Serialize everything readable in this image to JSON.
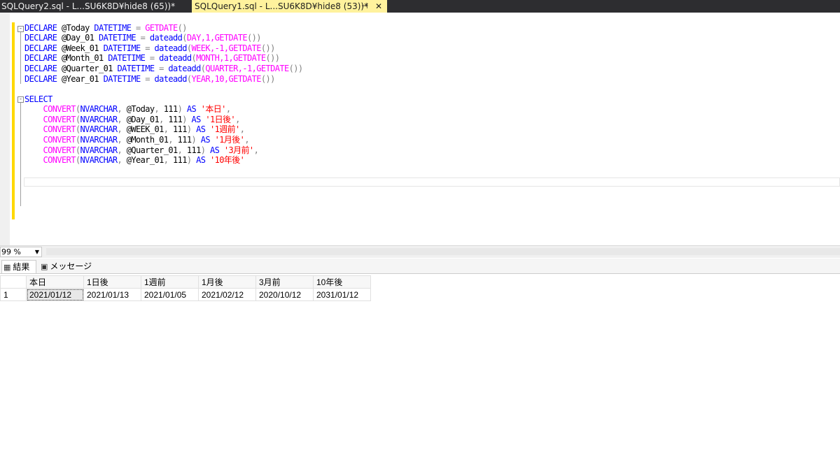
{
  "tabs": [
    {
      "label": "SQLQuery2.sql - L...SU6K8D¥hide8 (65))*",
      "active": false
    },
    {
      "label": "SQLQuery1.sql - L...SU6K8D¥hide8 (53))*",
      "active": true,
      "pin_icon": "pin-icon",
      "close_icon": "close-icon"
    }
  ],
  "editor": {
    "declares": [
      {
        "var": "@Today",
        "type": "DATETIME",
        "fn": "GETDATE",
        "args": ""
      },
      {
        "var": "@Day_01",
        "type": "DATETIME",
        "fn": "dateadd",
        "args": "DAY,1,"
      },
      {
        "var": "@Week_01",
        "type": "DATETIME",
        "fn": "dateadd",
        "args": "WEEK,-1,"
      },
      {
        "var": "@Month_01",
        "type": "DATETIME",
        "fn": "dateadd",
        "args": "MONTH,1,"
      },
      {
        "var": "@Quarter_01",
        "type": "DATETIME",
        "fn": "dateadd",
        "args": "QUARTER,-1,"
      },
      {
        "var": "@Year_01",
        "type": "DATETIME",
        "fn": "dateadd",
        "args": "YEAR,10,"
      }
    ],
    "select_keyword": "SELECT",
    "declare_keyword": "DECLARE",
    "converts": [
      {
        "var": "@Today",
        "alias": "'本日'",
        "sep": ","
      },
      {
        "var": "@Day_01",
        "alias": "'1日後'",
        "sep": ","
      },
      {
        "var": "@WEEK_01",
        "alias": "'1週前'",
        "sep": ","
      },
      {
        "var": "@Month_01",
        "alias": "'1月後'",
        "sep": ","
      },
      {
        "var": "@Quarter_01",
        "alias": "'3月前'",
        "sep": ","
      },
      {
        "var": "@Year_01",
        "alias": "'10年後'",
        "sep": ""
      }
    ]
  },
  "zoom": {
    "value": "99 %"
  },
  "result_tabs": [
    {
      "label": "結果",
      "icon": "grid-icon",
      "active": true
    },
    {
      "label": "メッセージ",
      "icon": "message-icon",
      "active": false
    }
  ],
  "results": {
    "columns": [
      "本日",
      "1日後",
      "1週前",
      "1月後",
      "3月前",
      "10年後"
    ],
    "rows": [
      {
        "num": "1",
        "cells": [
          "2021/01/12",
          "2021/01/13",
          "2021/01/05",
          "2021/02/12",
          "2020/10/12",
          "2031/01/12"
        ]
      }
    ]
  }
}
